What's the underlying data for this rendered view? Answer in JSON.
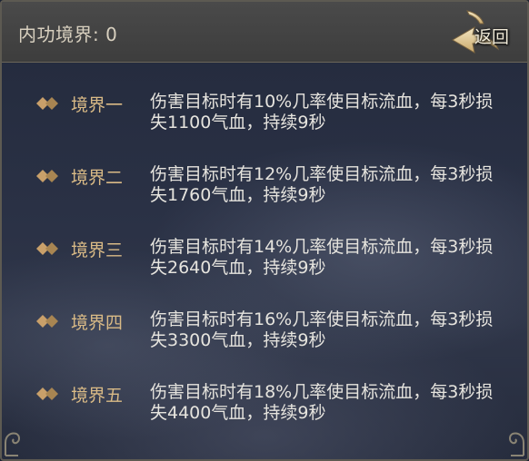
{
  "header": {
    "title": "内功境界: 0",
    "back_label": "返回"
  },
  "colors": {
    "label": "#d9ba86",
    "text": "#e6e4de",
    "header_bg": "#444444",
    "border": "#5d5a52"
  },
  "icons": {
    "row_bullet": "double-diamond-icon",
    "back": "back-arrow-icon",
    "corner": "cloud-corner-ornament"
  },
  "realms": [
    {
      "label": "境界一",
      "desc": "伤害目标时有10%几率使目标流血，每3秒损失1100气血，持续9秒"
    },
    {
      "label": "境界二",
      "desc": "伤害目标时有12%几率使目标流血，每3秒损失1760气血，持续9秒"
    },
    {
      "label": "境界三",
      "desc": "伤害目标时有14%几率使目标流血，每3秒损失2640气血，持续9秒"
    },
    {
      "label": "境界四",
      "desc": "伤害目标时有16%几率使目标流血，每3秒损失3300气血，持续9秒"
    },
    {
      "label": "境界五",
      "desc": "伤害目标时有18%几率使目标流血，每3秒损失4400气血，持续9秒"
    }
  ]
}
